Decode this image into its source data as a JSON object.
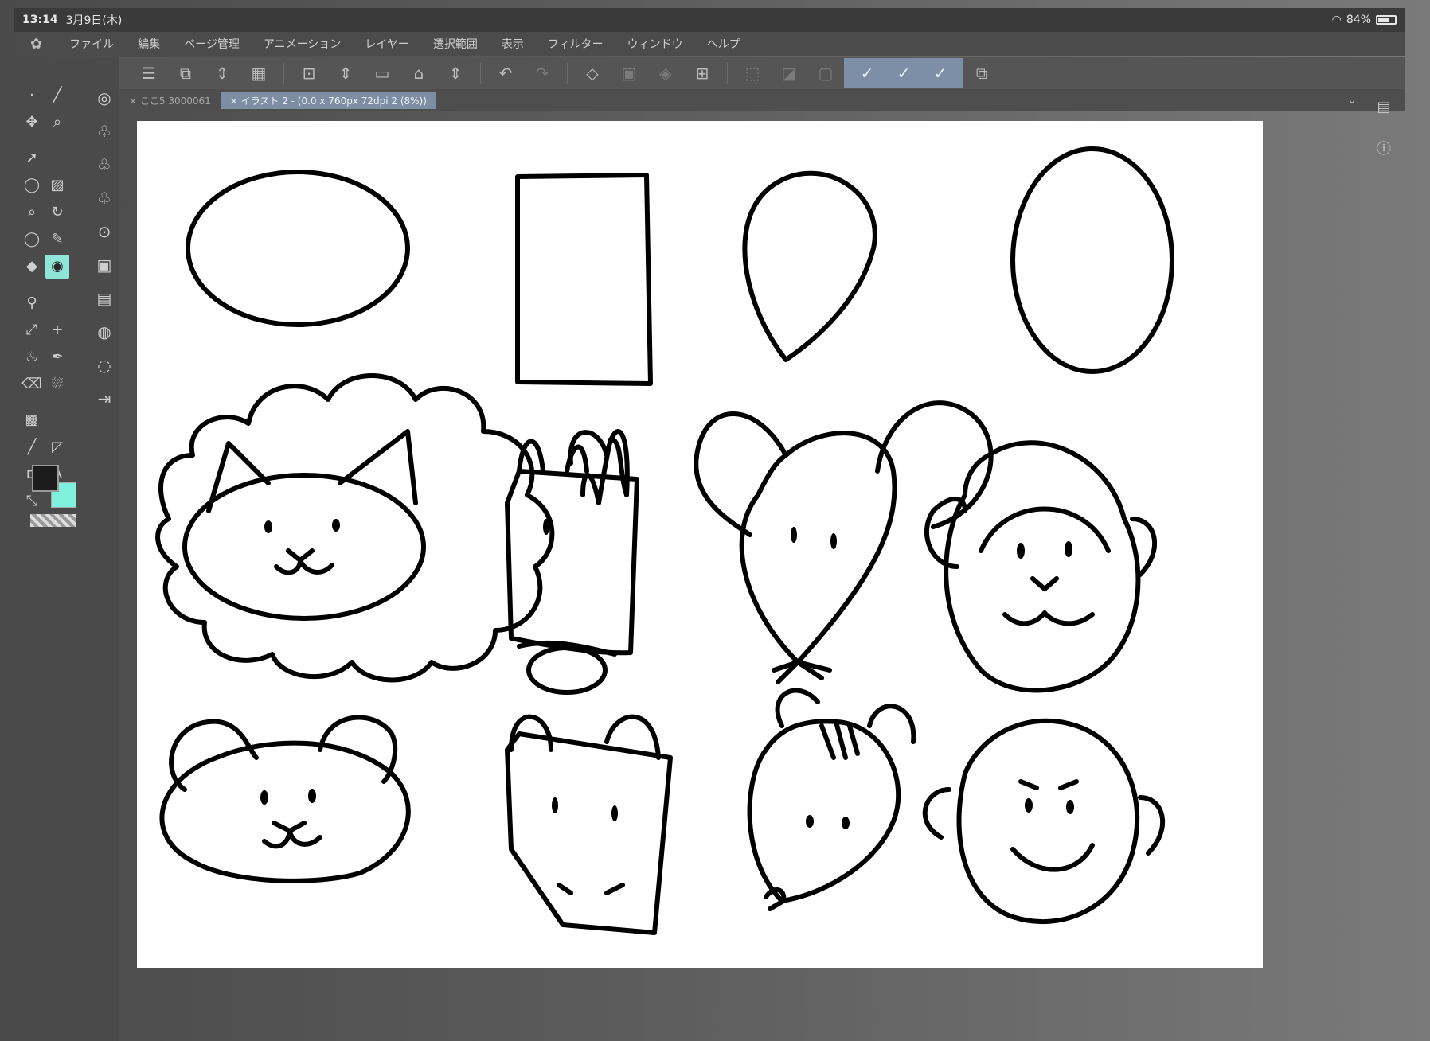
{
  "statusbar": {
    "time": "13:14",
    "title": "3月9日(木)",
    "battery": "84%"
  },
  "menu": [
    {
      "label": "ファイル"
    },
    {
      "label": "編集"
    },
    {
      "label": "ページ管理"
    },
    {
      "label": "アニメーション"
    },
    {
      "label": "レイヤー"
    },
    {
      "label": "選択範囲"
    },
    {
      "label": "表示"
    },
    {
      "label": "フィルター"
    },
    {
      "label": "ウィンドウ"
    },
    {
      "label": "ヘルプ"
    }
  ],
  "tabs": [
    {
      "label": "× ここ5 3000061"
    },
    {
      "label": "× イラスト 2 - (0.0 x 760px 72dpi 2 (8%))"
    }
  ],
  "colors": {
    "main": "#1c1c1c",
    "sub": "#7ff0dc",
    "accent": "#7c8da4"
  },
  "canvas": {
    "drawings": [
      "oval",
      "rectangle",
      "teardrop",
      "tall-oval",
      "lion",
      "horse",
      "mouse",
      "monkey",
      "bear",
      "cat",
      "hamster",
      "monkey-smile"
    ]
  }
}
